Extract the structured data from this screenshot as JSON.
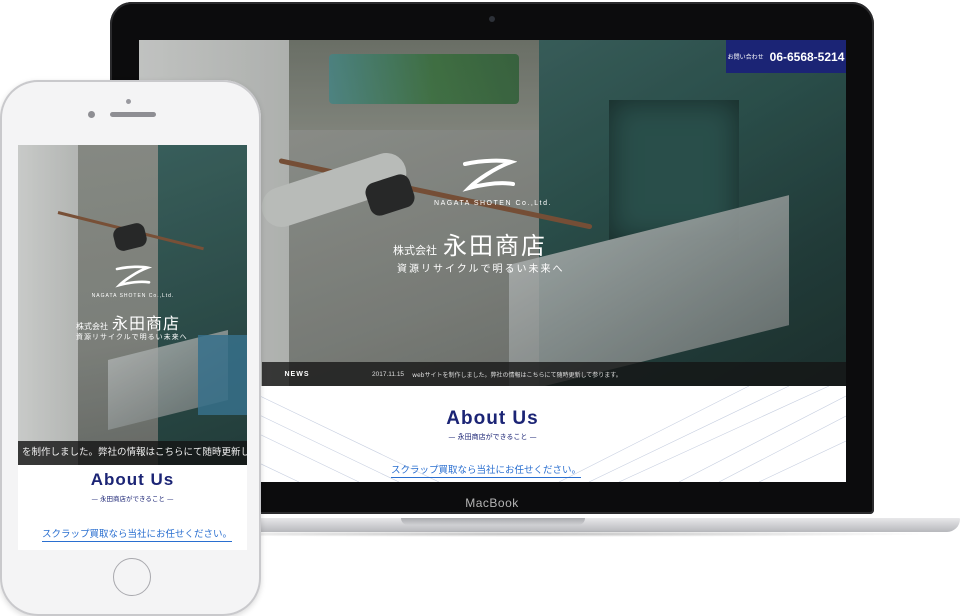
{
  "laptop": {
    "brand_label": "MacBook",
    "site": {
      "contact": {
        "label": "お問い合わせ",
        "phone": "06-6568-5214"
      },
      "logo": {
        "english": "NAGATA SHOTEN Co.,Ltd.",
        "kabushiki": "株式会社",
        "name": "永田商店",
        "tagline": "資源リサイクルで明るい未来へ"
      },
      "news": {
        "label": "NEWS",
        "date": "2017.11.15",
        "text": "webサイトを制作しました。弊社の情報はこちらにて随時更新して参ります。"
      },
      "about": {
        "title": "About Us",
        "subtitle": "— 永田商店ができること —",
        "link": "スクラップ買取なら当社にお任せください。"
      }
    }
  },
  "phone": {
    "site": {
      "logo": {
        "english": "NAGATA SHOTEN Co.,Ltd.",
        "kabushiki": "株式会社",
        "name": "永田商店",
        "tagline": "資源リサイクルで明るい未来へ"
      },
      "news": {
        "text": "を制作しました。弊社の情報はこちらにて随時更新して参"
      },
      "about": {
        "title": "About Us",
        "subtitle": "— 永田商店ができること —",
        "link": "スクラップ買取なら当社にお任せください。"
      }
    }
  },
  "colors": {
    "accent": "#1b2475",
    "link": "#2a6fd0"
  }
}
